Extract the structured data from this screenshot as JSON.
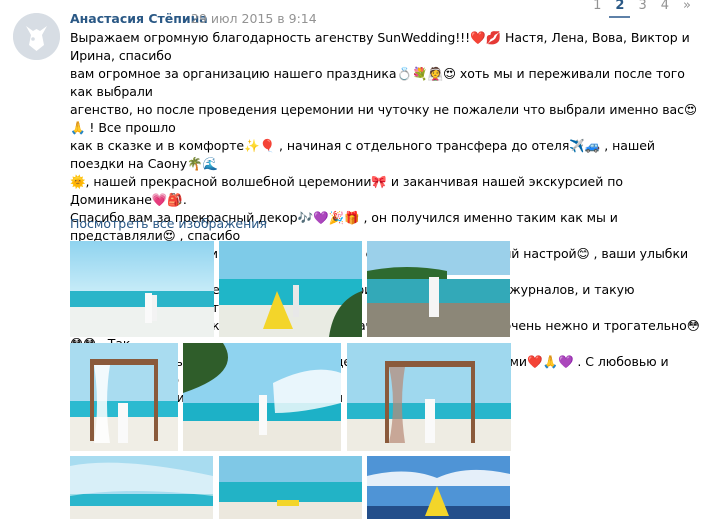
{
  "post": {
    "author": "Анастасия Стёпина",
    "date": "29 июл 2015 в 9:14",
    "text": "Выражаем огромную благодарность агенству SunWedding!!!❤️💋 Настя, Лена, Вова, Виктор и Ирина, спасибо\nвам огромное за организацию нашего праздника💍💐👰😍 хоть мы и переживали после того как выбрали\nагенство, но после проведения церемонии ни чуточку не пожалели что выбрали именно вас😍🙏 ! Все прошло\nкак в сказке и в комфорте✨🎈 , начиная с отдельного трансфера до отеля✈️🚙 , нашей поездки на Саону🌴🌊\n🌞, нашей прекрасной волшебной церемонии🎀 и заканчивая нашей экскурсией по Доминикане💗🎒.\nСпасибо вам за прекрасный декор🎶💜🎉🎁 , он получился именно таким как мы и представляли😍 , спасибо\nвам за теплые слова и поздравления😳😳😊 , спасибо за позитивный настрой😊 , ваши улыбки и праздничную\nатмосферу, отдельное спасибо за фотографии📷 к как с обложек журналов, и такую чувственную и романтичную\nвидеосъемку🎬 , при каждом просмотре плачем, все получилось очень нежно и трогательно😳😳😳 . Так\nхочется прожить еще раз этот день и еще раз именно вместе с вами❤️🙏💜 . С любовью и благодарностью и с\nсамыми лучшими воспоминаниями семья Стёпиных👫😊😊😊",
    "show_all_label": "Посмотреть все изображения"
  },
  "pager": {
    "items": [
      "1",
      "2",
      "3",
      "4",
      "»"
    ],
    "current": "2"
  },
  "colors": {
    "link": "#2a5885",
    "date": "#939393",
    "text": "#000000"
  },
  "photos": [
    {
      "name": "photo-1",
      "subject": "couple on beach, turquoise sea"
    },
    {
      "name": "photo-2",
      "subject": "bride in yellow dress under palm"
    },
    {
      "name": "photo-3",
      "subject": "couple on rocky shore"
    },
    {
      "name": "photo-4",
      "subject": "wedding arch with white drapes"
    },
    {
      "name": "photo-5",
      "subject": "couple with flying veil"
    },
    {
      "name": "photo-6",
      "subject": "couple under arch"
    },
    {
      "name": "photo-7",
      "subject": "couple on beach under veil"
    },
    {
      "name": "photo-8",
      "subject": "bride lying on sand"
    },
    {
      "name": "photo-9",
      "subject": "bride in yellow on rocks"
    }
  ]
}
